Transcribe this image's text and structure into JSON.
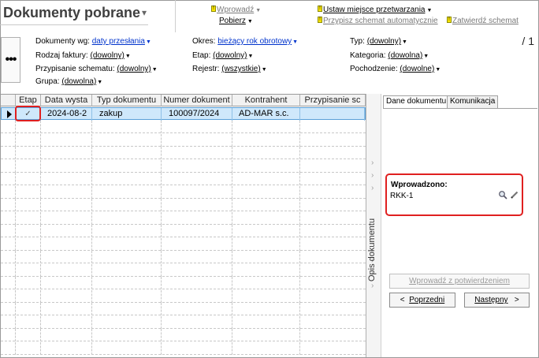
{
  "header": {
    "title": "Dokumenty pobrane",
    "actions": {
      "wprowadz": "Wprowadź",
      "pobierz": "Pobierz",
      "ustaw": "Ustaw miejsce przetwarzania",
      "przypisz": "Przypisz schemat automatycznie",
      "zatwierdz": "Zatwierdź schemat"
    },
    "page_counter": "/ 1"
  },
  "filters": {
    "dokumenty_wg": {
      "label": "Dokumenty wg:",
      "value": "daty przesłania"
    },
    "rodzaj_faktury": {
      "label": "Rodzaj faktury:",
      "value": "(dowolny)"
    },
    "przypisanie": {
      "label": "Przypisanie schematu:",
      "value": "(dowolny)"
    },
    "grupa": {
      "label": "Grupa:",
      "value": "(dowolna)"
    },
    "okres": {
      "label": "Okres:",
      "value": "bieżący rok obrotowy"
    },
    "etap": {
      "label": "Etap:",
      "value": "(dowolny)"
    },
    "rejestr": {
      "label": "Rejestr:",
      "value": "(wszystkie)"
    },
    "typ": {
      "label": "Typ:",
      "value": "(dowolny)"
    },
    "kategoria": {
      "label": "Kategoria:",
      "value": "(dowolna)"
    },
    "pochodzenie": {
      "label": "Pochodzenie:",
      "value": "(dowolne)"
    }
  },
  "grid": {
    "columns": [
      "Etap",
      "Data wysta",
      "Typ dokumentu",
      "Numer dokument",
      "Kontrahent",
      "Przypisanie sc"
    ],
    "rows": [
      {
        "etap": "✓",
        "data": "2024-08-2",
        "typ": "zakup",
        "numer": "100097/2024",
        "kontrahent": "AD-MAR s.c.",
        "przypisanie": ""
      }
    ]
  },
  "side": {
    "collapsed_label": "Opis dokumentu",
    "tabs": [
      "Dane dokumentu",
      "Komunikacja"
    ],
    "wprowadzono_label": "Wprowadzono:",
    "wprowadzono_value": "RKK-1",
    "btn_wprowadz": "Wprowadź z potwierdzeniem",
    "btn_poprzedni": "Poprzedni",
    "btn_nastepny": "Następny"
  },
  "colors": {
    "highlight": "#e02020",
    "selection": "#cfe8fb",
    "link": "#0033cc"
  }
}
